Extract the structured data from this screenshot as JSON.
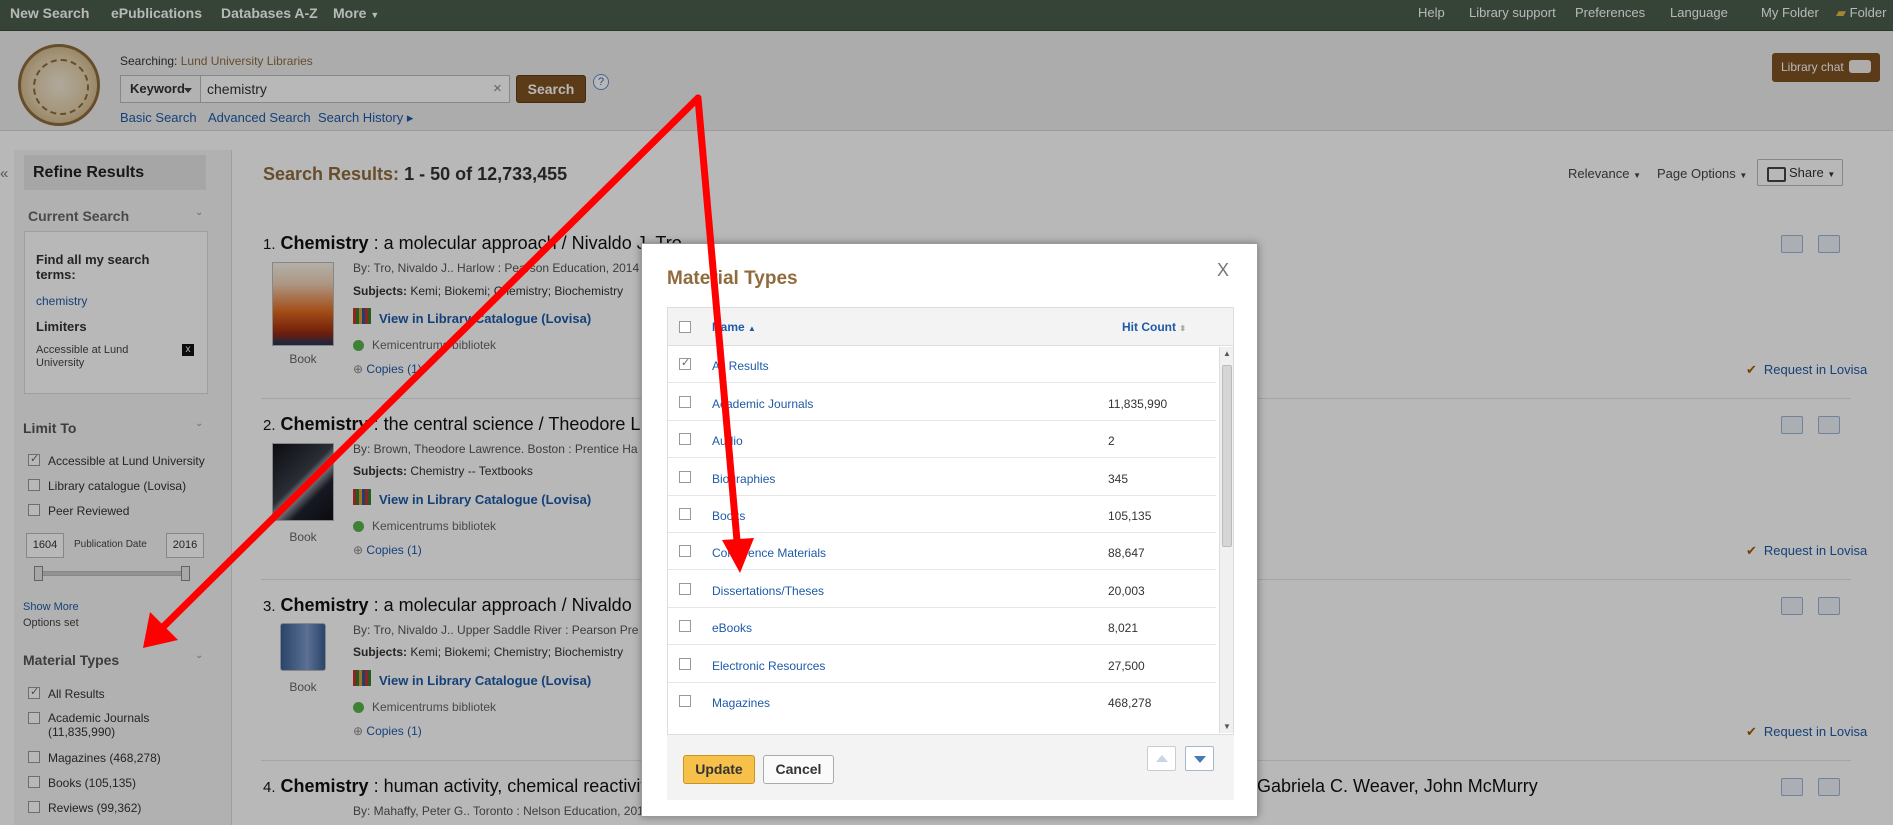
{
  "topnav": {
    "left": [
      "New Search",
      "ePublications",
      "Databases A-Z",
      "More"
    ],
    "right": [
      "Help",
      "Library support",
      "Preferences",
      "Language",
      "My Folder",
      "Folder"
    ]
  },
  "header": {
    "searching_label": "Searching:",
    "searching_target": "Lund University Libraries",
    "field": "Keyword",
    "query": "chemistry",
    "clear": "×",
    "search_button": "Search",
    "help": "?",
    "links": [
      "Basic Search",
      "Advanced Search",
      "Search History ▸"
    ],
    "chat": "Library chat"
  },
  "sidebar": {
    "collapse": "«",
    "refine": "Refine Results",
    "current_search": "Current Search",
    "find_all": "Find all my search terms:",
    "term": "chemistry",
    "limiters": "Limiters",
    "limiter_value": "Accessible at Lund University",
    "limiter_remove": "x",
    "limit_to": "Limit To",
    "limit_items": [
      {
        "label": "Accessible at Lund University",
        "checked": true
      },
      {
        "label": "Library catalogue (Lovisa)",
        "checked": false
      },
      {
        "label": "Peer Reviewed",
        "checked": false
      }
    ],
    "pub_from": "1604",
    "pub_label": "Publication Date",
    "pub_to": "2016",
    "show_more": "Show More",
    "options_set": "Options set",
    "material_types": "Material Types",
    "material_items": [
      {
        "label": "All Results",
        "checked": true
      },
      {
        "label": "Academic Journals",
        "count": "(11,835,990)",
        "checked": false
      },
      {
        "label": "Magazines (468,278)",
        "checked": false
      },
      {
        "label": "Books (105,135)",
        "checked": false
      },
      {
        "label": "Reviews (99,362)",
        "checked": false
      }
    ]
  },
  "results": {
    "title_prefix": "Search Results:",
    "title_range": "1 - 50 of 12,733,455",
    "relevance": "Relevance",
    "page_options": "Page Options",
    "share": "Share",
    "items": [
      {
        "num": "1.",
        "title": "Chemistry",
        "rest": " : a molecular approach / Nivaldo J. Tro",
        "by": "By: Tro, Nivaldo J.. Harlow : Pearson Education, 2014",
        "subjects_label": "Subjects:",
        "subjects": "Kemi; Biokemi; Chemistry; Biochemistry",
        "view": "View in Library Catalogue (Lovisa)",
        "location": "Kemicentrums bibliotek",
        "copies": "Copies (1)",
        "type": "Book",
        "request": "Request in Lovisa"
      },
      {
        "num": "2.",
        "title": "Chemistry",
        "rest": " : the central science / Theodore L",
        "by": "By: Brown, Theodore Lawrence. Boston : Prentice Ha",
        "subjects_label": "Subjects:",
        "subjects": "Chemistry -- Textbooks",
        "view": "View in Library Catalogue (Lovisa)",
        "location": "Kemicentrums bibliotek",
        "copies": "Copies (1)",
        "type": "Book",
        "request": "Request in Lovisa"
      },
      {
        "num": "3.",
        "title": "Chemistry",
        "rest": " : a molecular approach / Nivaldo",
        "by": "By: Tro, Nivaldo J.. Upper Saddle River : Pearson Pre",
        "subjects_label": "Subjects:",
        "subjects": "Kemi; Biokemi; Chemistry; Biochemistry",
        "view": "View in Library Catalogue (Lovisa)",
        "location": "Kemicentrums bibliotek",
        "copies": "Copies (1)",
        "type": "Book",
        "request": "Request in Lovisa"
      },
      {
        "num": "4.",
        "title": "Chemistry",
        "rest": " : human activity, chemical reactivit",
        "rest_right": "Gabriela C. Weaver, John McMurry",
        "by": "By: Mahaffy, Peter G.. Toronto : Nelson Education, 201"
      }
    ]
  },
  "modal": {
    "title": "Material Types",
    "close": "X",
    "col_name": "Name",
    "col_count": "Hit Count",
    "rows": [
      {
        "label": "All Results",
        "count": "",
        "checked": true
      },
      {
        "label": "Academic Journals",
        "count": "11,835,990",
        "checked": false
      },
      {
        "label": "Audio",
        "count": "2",
        "checked": false
      },
      {
        "label": "Biographies",
        "count": "345",
        "checked": false
      },
      {
        "label": "Books",
        "count": "105,135",
        "checked": false
      },
      {
        "label": "Conference Materials",
        "count": "88,647",
        "checked": false
      },
      {
        "label": "Dissertations/Theses",
        "count": "20,003",
        "checked": false
      },
      {
        "label": "eBooks",
        "count": "8,021",
        "checked": false
      },
      {
        "label": "Electronic Resources",
        "count": "27,500",
        "checked": false
      },
      {
        "label": "Magazines",
        "count": "468,278",
        "checked": false
      }
    ],
    "update": "Update",
    "cancel": "Cancel"
  },
  "colors": {
    "accent_brown": "#8f6b3d",
    "nav_bg": "#4a5f4d",
    "link_blue": "#1e5aa8",
    "update_yellow": "#f6c04a",
    "annotation_red": "#ff0000"
  }
}
